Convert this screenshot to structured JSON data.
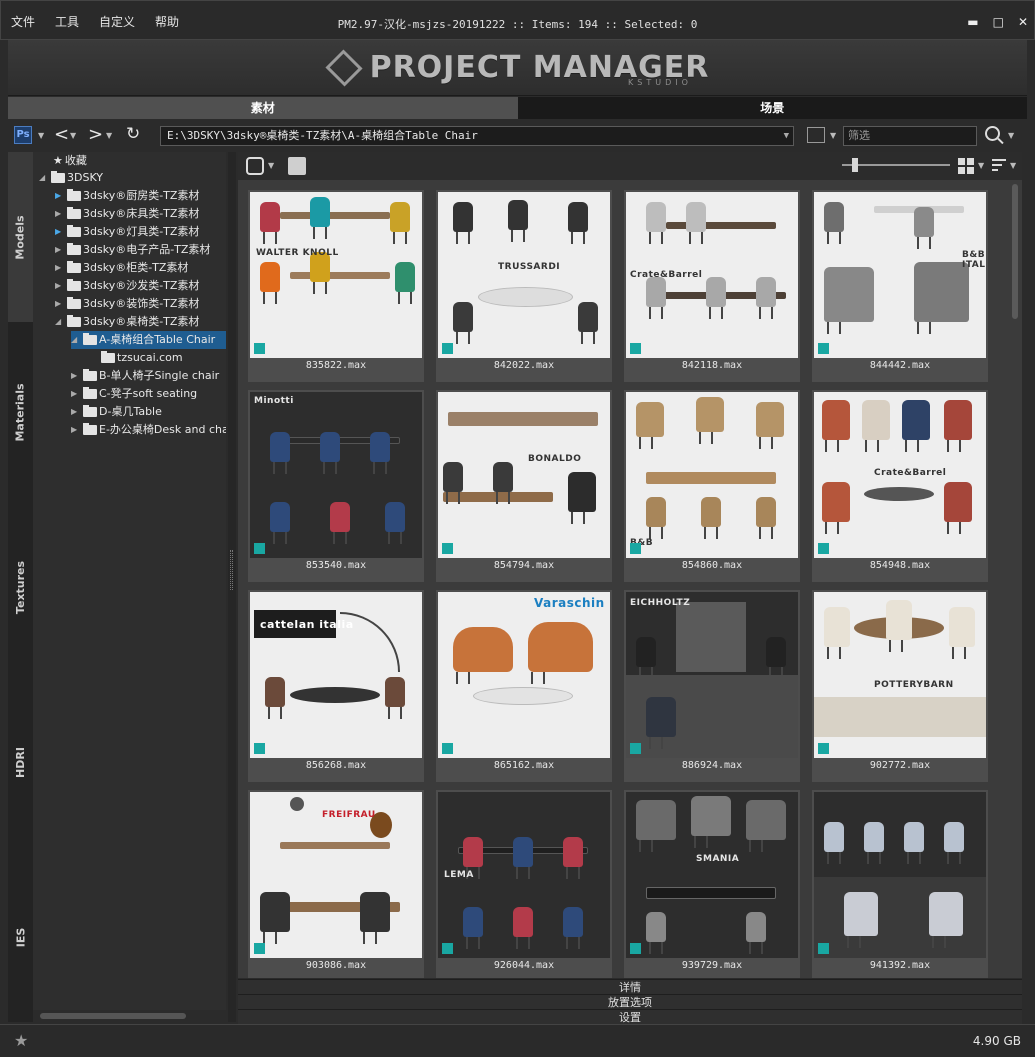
{
  "menu": [
    "文件",
    "工具",
    "自定义",
    "帮助"
  ],
  "window_title": "PM2.97-汉化-msjzs-20191222  :: Items: 194  :: Selected: 0",
  "window_controls": {
    "minimize": "▬",
    "maximize": "□",
    "close": "✕"
  },
  "banner": {
    "title": "PROJECT MANAGER",
    "subtitle": "KSTUDIO"
  },
  "top_tabs": [
    "素材",
    "场景"
  ],
  "path": "E:\\3DSKY\\3dsky®桌椅类-TZ素材\\A-桌椅组合Table Chair",
  "filter_placeholder": "筛选",
  "side_tabs": [
    "Models",
    "Materials",
    "Textures",
    "HDRI",
    "IES"
  ],
  "tree": {
    "favorites": "收藏",
    "root": "3DSKY",
    "folders": [
      "3dsky®厨房类-TZ素材",
      "3dsky®床具类-TZ素材",
      "3dsky®灯具类-TZ素材",
      "3dsky®电子产品-TZ素材",
      "3dsky®柜类-TZ素材",
      "3dsky®沙发类-TZ素材",
      "3dsky®装饰类-TZ素材",
      "3dsky®桌椅类-TZ素材"
    ],
    "selected": "A-桌椅组合Table Chair",
    "file": "tzsucai.com",
    "subfolders": [
      "B-单人椅子Single chair",
      "C-凳子soft seating",
      "D-桌几Table",
      "E-办公桌椅Desk and chair"
    ]
  },
  "items": [
    {
      "label": "835822.max",
      "brand": "WALTER KNOLL"
    },
    {
      "label": "842022.max",
      "brand": "TRUSSARDI"
    },
    {
      "label": "842118.max",
      "brand": "Crate&Barrel"
    },
    {
      "label": "844442.max",
      "brand": "B&B ITALIA"
    },
    {
      "label": "853540.max",
      "brand": "Minotti"
    },
    {
      "label": "854794.max",
      "brand": "BONALDO"
    },
    {
      "label": "854860.max",
      "brand": "B&B"
    },
    {
      "label": "854948.max",
      "brand": "Crate&Barrel"
    },
    {
      "label": "856268.max",
      "brand": "cattelan italia"
    },
    {
      "label": "865162.max",
      "brand": "Varaschin"
    },
    {
      "label": "886924.max",
      "brand": "EICHHOLTZ"
    },
    {
      "label": "902772.max",
      "brand": "POTTERYBARN"
    },
    {
      "label": "903086.max",
      "brand": "FREIFRAU"
    },
    {
      "label": "926044.max",
      "brand": "LEMA"
    },
    {
      "label": "939729.max",
      "brand": "SMANIA"
    },
    {
      "label": "941392.max",
      "brand": ""
    }
  ],
  "bottom_panels": [
    "详情",
    "放置选项",
    "设置"
  ],
  "status": {
    "size": "4.90 GB"
  }
}
